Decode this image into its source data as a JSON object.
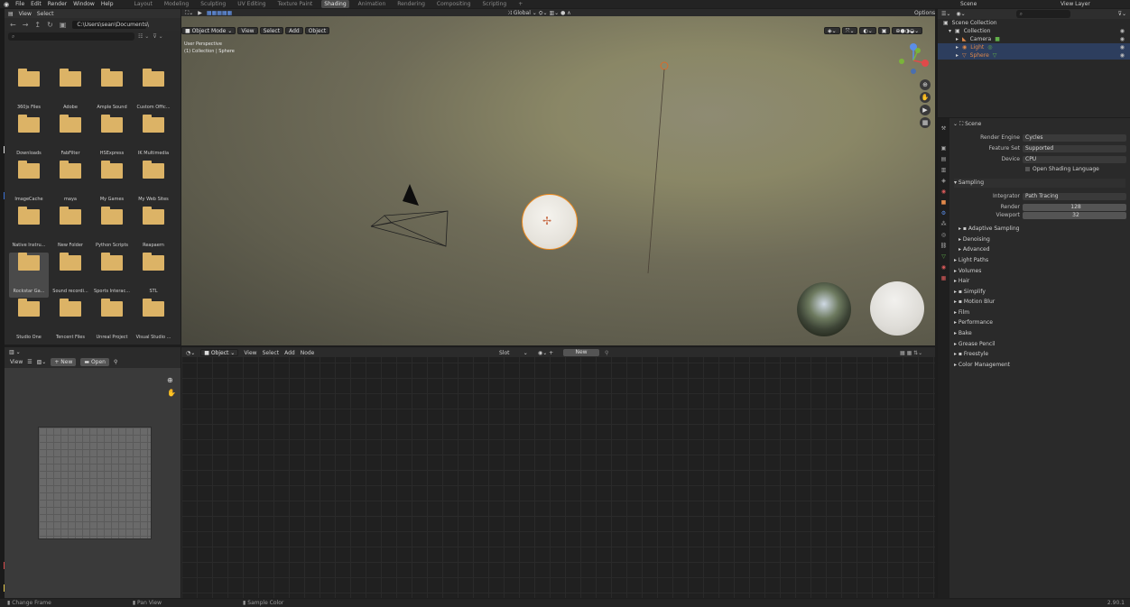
{
  "top": {
    "menus": [
      "File",
      "Edit",
      "Render",
      "Window",
      "Help"
    ],
    "workspaces": [
      "Layout",
      "Modeling",
      "Sculpting",
      "UV Editing",
      "Texture Paint",
      "Shading",
      "Animation",
      "Rendering",
      "Compositing",
      "Scripting",
      "+"
    ],
    "active_workspace": "Shading",
    "scene_label": "Scene",
    "view_layer_label": "View Layer"
  },
  "file_browser": {
    "header_view": "View",
    "header_select": "Select",
    "path": "C:\\Users\\sean\\Documents\\",
    "folders": [
      "360js Files",
      "Adobe",
      "Ample Sound",
      "Custom Offic...",
      "Downloads",
      "FabFilter",
      "HSExpress",
      "IK Multimedia",
      "ImageCache",
      "maya",
      "My Games",
      "My Web Sites",
      "Native Instru...",
      "New Folder",
      "Python Scripts",
      "Reapaern",
      "Rockstar Ga...",
      "Sound recordi...",
      "Sports Interac...",
      "STL",
      "Studio One",
      "Tencent Files",
      "Unreal Project",
      "Visual Studio ...",
      ""
    ],
    "selected_index": 16
  },
  "image_editor": {
    "view": "View",
    "new_label": "New",
    "open_label": "Open"
  },
  "viewport": {
    "mode": "Object Mode",
    "menus": [
      "View",
      "Select",
      "Add",
      "Object"
    ],
    "transform": "Global",
    "options": "Options",
    "perspective": "User Perspective",
    "collection": "(1) Collection | Sphere"
  },
  "node_editor": {
    "type": "Object",
    "menus": [
      "View",
      "Select",
      "Add",
      "Node"
    ],
    "slot": "Slot",
    "new_label": "New"
  },
  "outliner": {
    "root": "Scene Collection",
    "collection": "Collection",
    "items": [
      {
        "name": "Camera",
        "color": "#e0884a",
        "selected": false
      },
      {
        "name": "Light",
        "color": "#e0884a",
        "selected": true
      },
      {
        "name": "Sphere",
        "color": "#e0884a",
        "selected": true
      }
    ]
  },
  "properties": {
    "scene": "Scene",
    "render_engine_label": "Render Engine",
    "render_engine": "Cycles",
    "feature_set_label": "Feature Set",
    "feature_set": "Supported",
    "device_label": "Device",
    "device": "CPU",
    "osl": "Open Shading Language",
    "sampling": "Sampling",
    "integrator_label": "Integrator",
    "integrator": "Path Tracing",
    "render_label": "Render",
    "render_samples": "128",
    "viewport_label": "Viewport",
    "viewport_samples": "32",
    "subsections": [
      "Adaptive Sampling",
      "Denoising",
      "Advanced"
    ],
    "panels": [
      "Light Paths",
      "Volumes",
      "Hair",
      "Simplify",
      "Motion Blur",
      "Film",
      "Performance",
      "Bake",
      "Grease Pencil",
      "Freestyle",
      "Color Management"
    ]
  },
  "status": {
    "items": [
      "Change Frame",
      "Pan View",
      "Sample Color"
    ],
    "version": "2.90.1"
  }
}
